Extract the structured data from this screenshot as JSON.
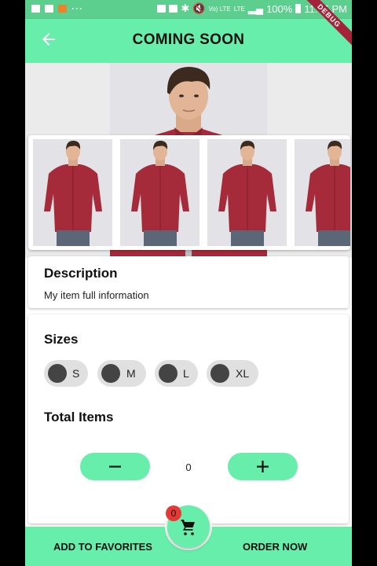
{
  "status_bar": {
    "battery": "100%",
    "time": "11:05 PM",
    "network_label": "Vo) LTE",
    "lte_label": "LTE",
    "more_dots": "···"
  },
  "app_bar": {
    "title": "COMING SOON",
    "debug_banner": "DEBUG"
  },
  "gallery": {
    "hero_image": "man-in-red-shirt",
    "thumbnails": [
      "man-in-red-shirt",
      "man-in-red-shirt",
      "man-in-red-shirt",
      "man-in-red-shirt"
    ]
  },
  "description": {
    "heading": "Description",
    "text": "My item full information"
  },
  "sizes": {
    "heading": "Sizes",
    "options": [
      "S",
      "M",
      "L",
      "XL"
    ]
  },
  "total_items": {
    "heading": "Total Items",
    "quantity": "0"
  },
  "bottom_bar": {
    "add_to_favorites": "ADD TO FAVORITES",
    "order_now": "ORDER NOW",
    "cart_count": "0"
  },
  "colors": {
    "accent": "#67eeaa",
    "status_bar": "#5ccf8f",
    "badge": "#e53935",
    "shirt": "#a62b3a"
  }
}
